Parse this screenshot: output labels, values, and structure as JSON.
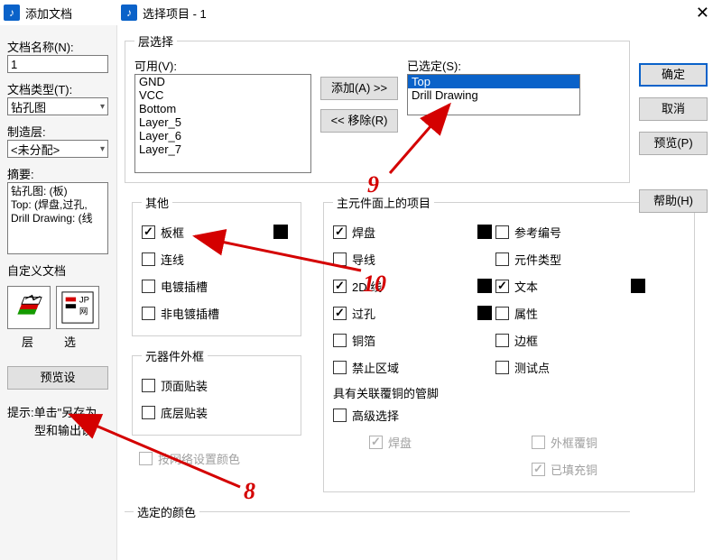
{
  "titlebar_left": "添加文档",
  "titlebar_right": "选择项目 - 1",
  "leftPane": {
    "docNameLabel": "文档名称(N):",
    "docNameValue": "1",
    "docTypeLabel": "文档类型(T):",
    "docTypeValue": "钻孔图",
    "fabLayerLabel": "制造层:",
    "fabLayerValue": "<未分配>",
    "summaryLabel": "摘要:",
    "summaryLines": [
      "钻孔图: (板)",
      "Top: (焊盘,过孔,",
      "Drill Drawing: (线"
    ],
    "customDocLabel": "自定义文档",
    "layerTab": "层",
    "selTab": "选",
    "previewBtn": "预览设",
    "hint1": "提示:单击\"另存为",
    "hint2": "型和输出设"
  },
  "dialog": {
    "layerGroup": "层选择",
    "availLabel": "可用(V):",
    "availItems": [
      "GND",
      "VCC",
      "Bottom",
      "Layer_5",
      "Layer_6",
      "Layer_7"
    ],
    "selectedLabel": "已选定(S):",
    "selectedItems": [
      "Top",
      "Drill Drawing"
    ],
    "addBtn": "添加(A) >>",
    "removeBtn": "<< 移除(R)",
    "otherGroup": "其他",
    "other": {
      "boardOutline": "板框",
      "connect": "连线",
      "platedSlot": "电镀插槽",
      "nonPlatedSlot": "非电镀插槽"
    },
    "compOutlineGroup": "元器件外框",
    "compOutline": {
      "top": "顶面贴装",
      "bottom": "底层贴装"
    },
    "mainItemsGroup": "主元件面上的项目",
    "mainItems": {
      "pad": "焊盘",
      "wire": "导线",
      "line2d": "2D 线",
      "via": "过孔",
      "copper": "铜箔",
      "keepout": "禁止区域",
      "refdes": "参考编号",
      "compType": "元件类型",
      "text": "文本",
      "attr": "属性",
      "border": "边框",
      "testpt": "测试点"
    },
    "assocCopperGroup": "具有关联覆铜的管脚",
    "advanced": "高级选择",
    "advPad": "焊盘",
    "advOutline": "外框覆铜",
    "advFilled": "已填充铜",
    "byNetColor": "按网络设置颜色",
    "selectedColorGroup": "选定的颜色",
    "buttons": {
      "ok": "确定",
      "cancel": "取消",
      "preview": "预览(P)",
      "help": "帮助(H)"
    }
  },
  "annotations": {
    "n8": "8",
    "n9": "9",
    "n10": "10"
  }
}
